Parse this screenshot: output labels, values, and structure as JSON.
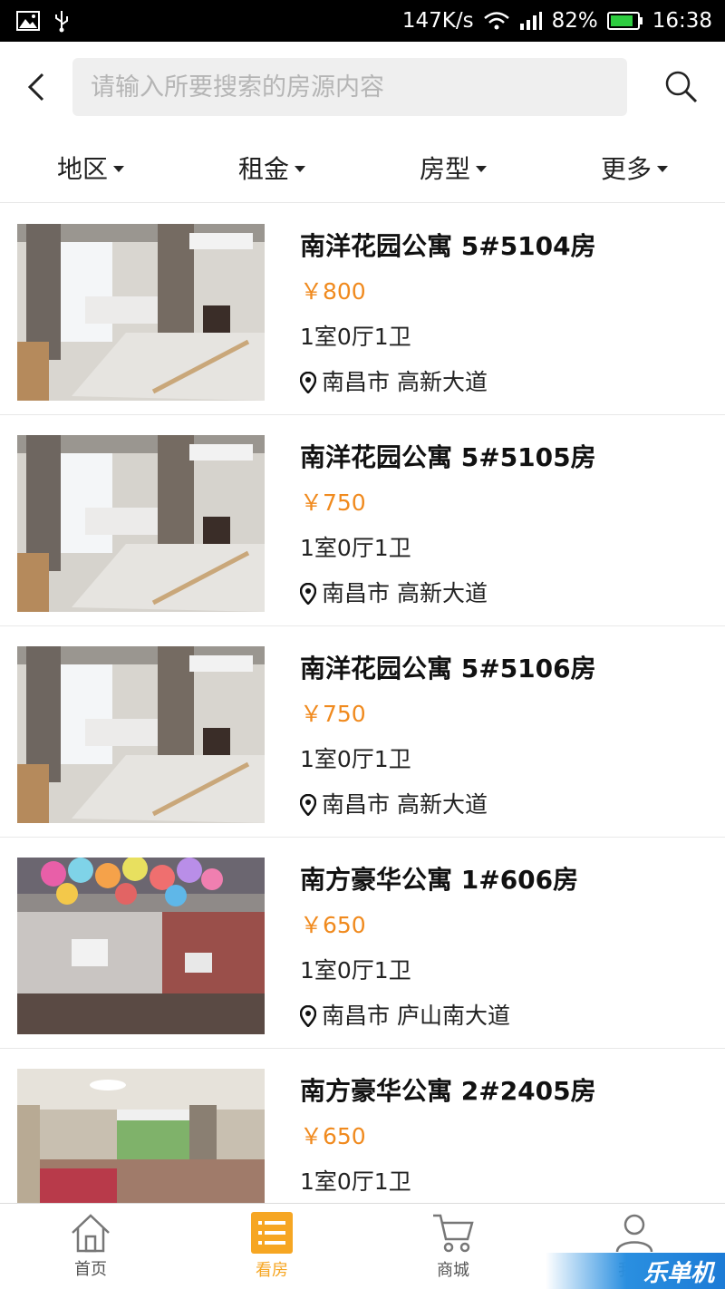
{
  "status_bar": {
    "speed": "147K/s",
    "battery": "82%",
    "time": "16:38"
  },
  "search": {
    "placeholder": "请输入所要搜索的房源内容",
    "value": ""
  },
  "filters": [
    {
      "label": "地区"
    },
    {
      "label": "租金"
    },
    {
      "label": "房型"
    },
    {
      "label": "更多"
    }
  ],
  "listings": [
    {
      "title": "南洋花园公寓 5#5104房",
      "price": "￥800",
      "layout": "1室0厅1卫",
      "location": "南昌市 高新大道",
      "image": "bedroom-photo"
    },
    {
      "title": "南洋花园公寓 5#5105房",
      "price": "￥750",
      "layout": "1室0厅1卫",
      "location": "南昌市 高新大道",
      "image": "bedroom-photo"
    },
    {
      "title": "南洋花园公寓 5#5106房",
      "price": "￥750",
      "layout": "1室0厅1卫",
      "location": "南昌市 高新大道",
      "image": "bedroom-photo"
    },
    {
      "title": "南方豪华公寓 1#606房",
      "price": "￥650",
      "layout": "1室0厅1卫",
      "location": "南昌市 庐山南大道",
      "image": "balloon-room-photo"
    },
    {
      "title": "南方豪华公寓 2#2405房",
      "price": "￥650",
      "layout": "1室0厅1卫",
      "location": "",
      "image": "room-photo"
    }
  ],
  "nav": [
    {
      "label": "首页",
      "icon": "home-icon"
    },
    {
      "label": "看房",
      "icon": "list-icon"
    },
    {
      "label": "商城",
      "icon": "cart-icon"
    },
    {
      "label": "我的",
      "icon": "user-icon"
    }
  ],
  "watermark": "乐单机",
  "colors": {
    "accent": "#f6a623",
    "price": "#f08a1e",
    "status_bar": "#000000"
  }
}
